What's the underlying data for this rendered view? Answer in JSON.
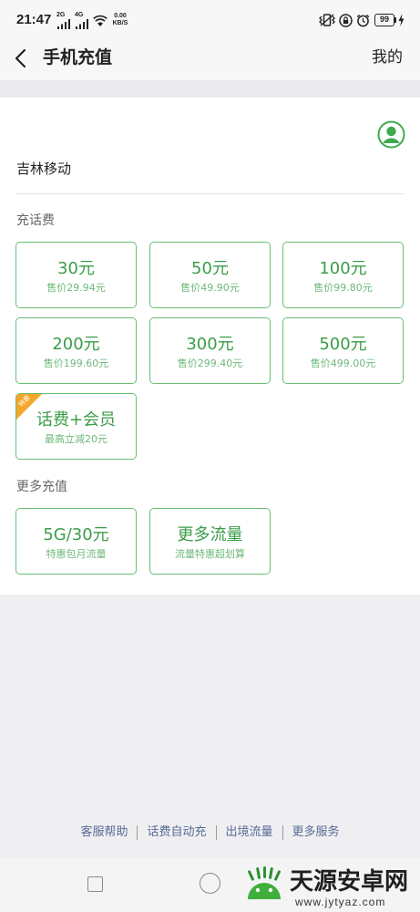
{
  "status_bar": {
    "time": "21:47",
    "net1": "2G",
    "net2": "4G",
    "speed_value": "0.00",
    "speed_unit": "KB/S",
    "battery": "99",
    "icons": [
      "signal-icon",
      "wifi-icon",
      "vibrate-icon",
      "lock-rotation-icon",
      "alarm-icon",
      "battery-icon",
      "charging-icon"
    ]
  },
  "header": {
    "title": "手机充值",
    "right_link": "我的",
    "back_icon": "chevron-left-icon"
  },
  "carrier": {
    "name": "吉林移动",
    "avatar_icon": "user-avatar-icon"
  },
  "topup": {
    "label": "充话费",
    "items": [
      {
        "amount": "30元",
        "price": "售价29.94元"
      },
      {
        "amount": "50元",
        "price": "售价49.90元"
      },
      {
        "amount": "100元",
        "price": "售价99.80元"
      },
      {
        "amount": "200元",
        "price": "售价199.60元"
      },
      {
        "amount": "300元",
        "price": "售价299.40元"
      },
      {
        "amount": "500元",
        "price": "售价499.00元"
      }
    ],
    "bundle": {
      "title": "话费+会员",
      "subtitle": "最高立减20元",
      "badge": "特惠"
    }
  },
  "more": {
    "label": "更多充值",
    "items": [
      {
        "title": "5G/30元",
        "subtitle": "特惠包月流量"
      },
      {
        "title": "更多流量",
        "subtitle": "流量特惠超划算"
      }
    ]
  },
  "footer_links": [
    "客服帮助",
    "话费自动充",
    "出境流量",
    "更多服务"
  ],
  "watermark": {
    "name": "天源安卓网",
    "url": "www.jytyaz.com"
  },
  "colors": {
    "accent": "#3a9d48",
    "border": "#67c073",
    "sub": "#6fb97a",
    "badge": "#f4a62a",
    "link": "#576b95",
    "avatar": "#3daa50"
  }
}
